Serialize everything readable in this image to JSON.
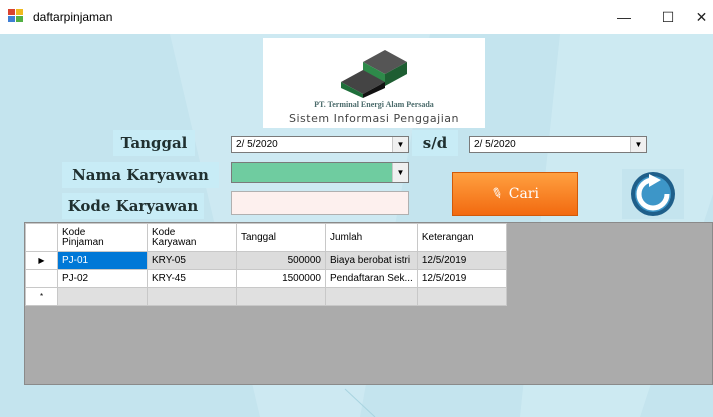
{
  "window": {
    "title": "daftarpinjaman",
    "minimize": "—",
    "maximize": "☐",
    "close": "✕"
  },
  "header": {
    "company": "PT. Terminal Energi Alam Persada",
    "system": "Sistem Informasi Penggajian"
  },
  "form": {
    "tanggal_label": "Tanggal",
    "date_from": "2/  5/2020",
    "sd_label": "s/d",
    "date_to": "2/  5/2020",
    "nama_label": "Nama Karyawan",
    "nama_value": "",
    "kode_label": "Kode Karyawan",
    "kode_value": "",
    "cari_label": "Cari"
  },
  "colors": {
    "accent": "#f26a10",
    "background": "#c4e4ee",
    "selection": "#0078d7",
    "combo_fill": "#6fcca0"
  },
  "grid": {
    "columns": [
      {
        "label": "Kode\nPinjaman"
      },
      {
        "label": "Kode\nKaryawan"
      },
      {
        "label": "Tanggal"
      },
      {
        "label": "Jumlah"
      },
      {
        "label": "Keterangan"
      }
    ],
    "rows": [
      {
        "kode_pinjaman": "PJ-01",
        "kode_karyawan": "KRY-05",
        "tanggal": "500000",
        "jumlah": "Biaya berobat istri",
        "keterangan": "12/5/2019"
      },
      {
        "kode_pinjaman": "PJ-02",
        "kode_karyawan": "KRY-45",
        "tanggal": "1500000",
        "jumlah": "Pendaftaran Sek...",
        "keterangan": "12/5/2019"
      }
    ],
    "current_row_marker": "▶",
    "new_row_marker": "*"
  }
}
